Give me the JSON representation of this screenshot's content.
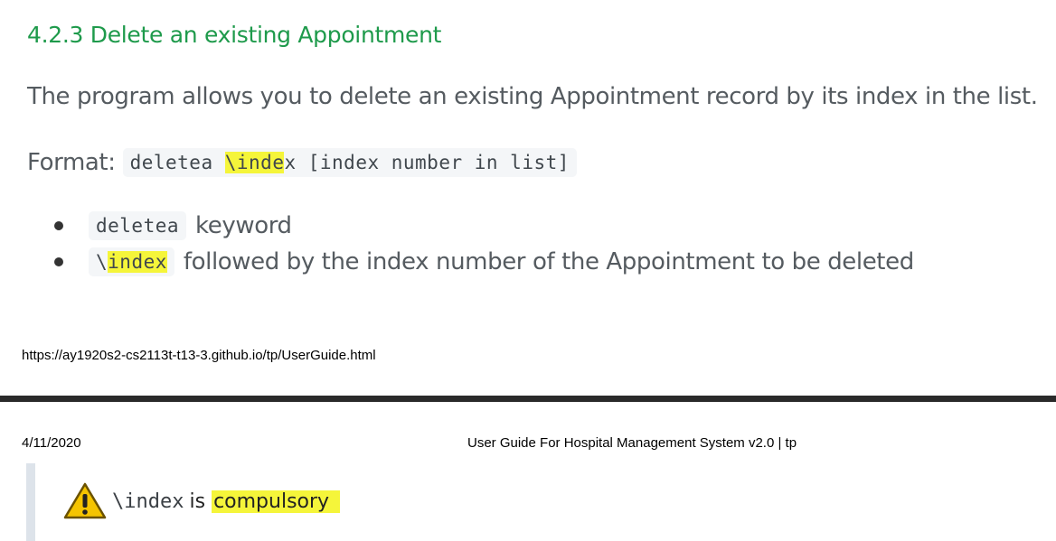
{
  "section": {
    "heading": "4.2.3 Delete an existing Appointment",
    "description": "The program allows you to delete an existing Appointment record by its index in the list.",
    "format_label": "Format:",
    "format_code": {
      "part1": "deletea ",
      "part2": "\\inde",
      "part3": "x [index number in list]"
    },
    "bullets": [
      {
        "code": "deletea",
        "text": "keyword"
      },
      {
        "code_prefix": "\\",
        "code_highlighted": "index",
        "text": "followed by the index number of the Appointment to be deleted"
      }
    ]
  },
  "page_footer": {
    "url": "https://ay1920s2-cs2113t-t13-3.github.io/tp/UserGuide.html"
  },
  "page_header": {
    "date": "4/11/2020",
    "doc_title": "User Guide For Hospital Management System v2.0 | tp"
  },
  "note": {
    "icon": "warning-icon",
    "code": "\\index",
    "text_plain": "is",
    "text_highlighted": "compulsory"
  },
  "colors": {
    "heading": "#1e9a4b",
    "body_text": "#555b60",
    "highlight": "#f5f53a"
  }
}
